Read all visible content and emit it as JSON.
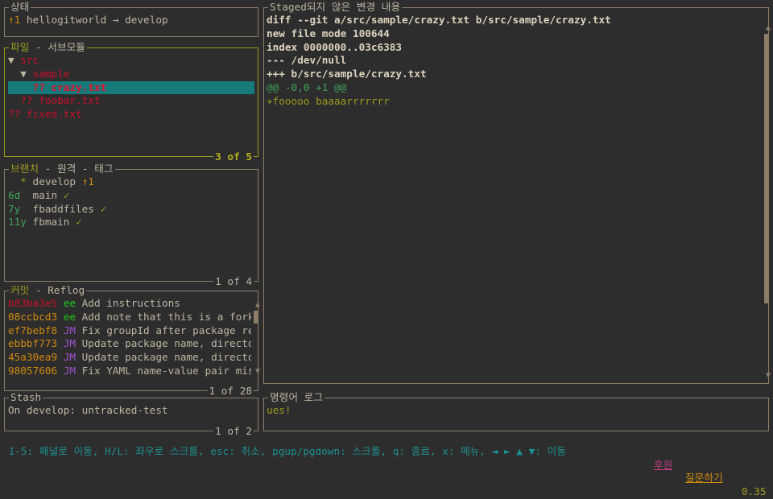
{
  "status": {
    "title": "상태",
    "ahead": "↑1",
    "text": " hellogitworld → develop"
  },
  "files": {
    "title": "파일",
    "title_suffix": " - 서브모듈",
    "footer": "3 of 5",
    "rows": [
      {
        "indent": "",
        "marker": "▼ ",
        "name": "src"
      },
      {
        "indent": "  ",
        "marker": "▼ ",
        "name": "sample"
      },
      {
        "indent": "    ",
        "marker": "?? ",
        "name": "crazy.txt",
        "selected": true
      },
      {
        "indent": "  ",
        "marker": "?? ",
        "name": "foobar.txt"
      },
      {
        "indent": "",
        "marker": "?? ",
        "name": "fixed.txt"
      }
    ]
  },
  "branches": {
    "title": "브랜치",
    "title_suffix": " - 원격 - 태그",
    "footer": "1 of 4",
    "rows": [
      {
        "age": "  *",
        "name": " develop ",
        "status": "↑1"
      },
      {
        "age": "6d ",
        "name": " main ",
        "status": "✓"
      },
      {
        "age": "7y ",
        "name": " fbaddfiles ",
        "status": "✓"
      },
      {
        "age": "11y",
        "name": " fbmain ",
        "status": "✓"
      }
    ]
  },
  "commits": {
    "title": "커밋",
    "title_suffix": " - Reflog",
    "footer": "1 of 28",
    "rows": [
      {
        "hash": "b83ba3e5",
        "author": "ee",
        "msg": "Add instructions"
      },
      {
        "hash": "08ccbcd3",
        "author": "ee",
        "msg": "Add note that this is a fork"
      },
      {
        "hash": "ef7bebf8",
        "author": "JM",
        "msg": "Fix groupId after package re"
      },
      {
        "hash": "ebbbf773",
        "author": "JM",
        "msg": "Update package name, directo"
      },
      {
        "hash": "45a30ea9",
        "author": "JM",
        "msg": "Update package name, directo"
      },
      {
        "hash": "98057606",
        "author": "JM",
        "msg": "Fix YAML name-value pair mis"
      }
    ]
  },
  "stash": {
    "title": "Stash",
    "footer": "1 of 2",
    "rows": [
      "On develop: untracked-test"
    ]
  },
  "diff": {
    "title": "Staged되지 않은 변경 내용",
    "header": [
      "diff --git a/src/sample/crazy.txt b/src/sample/crazy.txt",
      "new file mode 100644",
      "index 0000000..03c6383",
      "--- /dev/null",
      "+++ b/src/sample/crazy.txt"
    ],
    "hunk": "@@ -0,0 +1 @@",
    "added": "+fooooo baaaarrrrrrr"
  },
  "cmdlog": {
    "title": "명령어 로그",
    "text": "ues!"
  },
  "statusbar": {
    "keys": "1-5: 패널로 이동, H/L: 좌우로 스크롤, esc: 취소, pgup/pgdown: 스크롤, q: 종료, x: 메뉴, ◄ ► ▲ ▼: 이동",
    "donate": "후원",
    "ask": "질문하기",
    "version": "0.35"
  }
}
